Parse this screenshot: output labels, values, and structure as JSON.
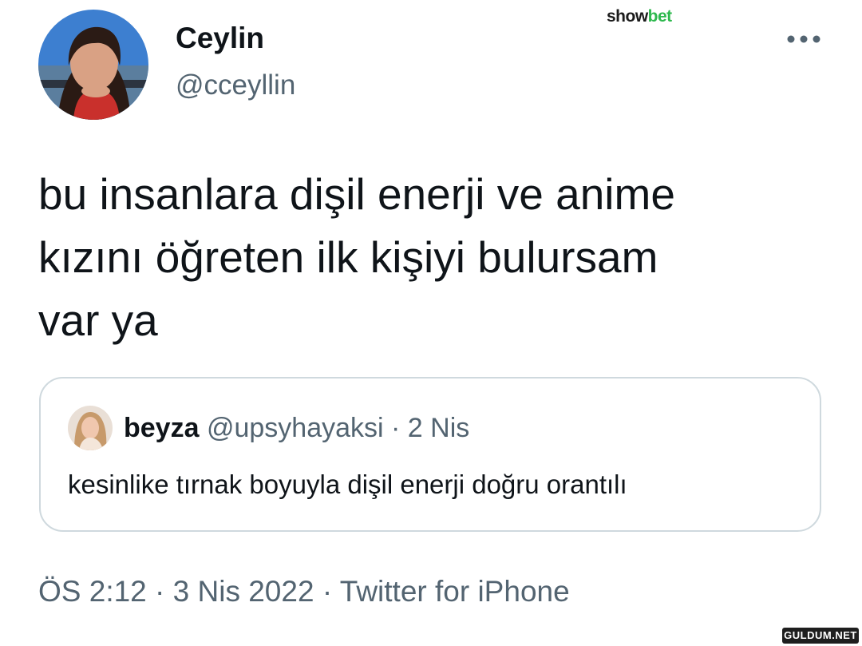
{
  "watermark_top": {
    "part1": "show",
    "part2": "bet"
  },
  "author": {
    "display_name": "Ceylin",
    "handle": "@cceyllin"
  },
  "tweet": {
    "text": "bu insanlara dişil enerji ve anime\nkızını öğreten ilk kişiyi bulursam\nvar ya"
  },
  "quote": {
    "name": "beyza",
    "meta": "@upsyhayaksi · 2 Nis",
    "text": "kesinlike tırnak boyuyla dişil enerji doğru orantılı"
  },
  "footer": {
    "time": "ÖS 2:12",
    "sep1": " · ",
    "date": "3 Nis 2022",
    "sep2": " · ",
    "source": "Twitter for iPhone"
  },
  "watermark_bottom": "GULDUM.NET",
  "icons": {
    "more": "more-horizontal-icon",
    "avatar": "profile-photo",
    "quote_avatar": "profile-photo"
  },
  "colors": {
    "text_primary": "#0f1419",
    "text_secondary": "#536471",
    "card_border": "#cfd9de",
    "watermark_green": "#2db84d"
  }
}
